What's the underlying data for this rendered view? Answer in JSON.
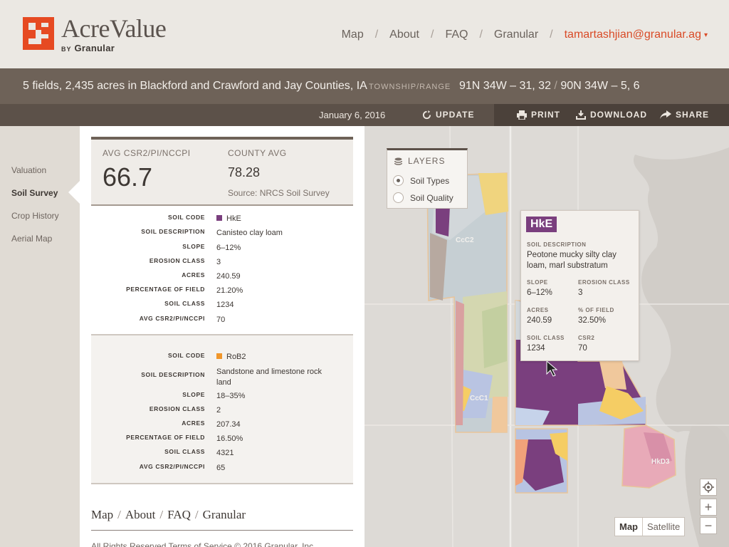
{
  "brand": {
    "name": "AcreValue",
    "by": "BY",
    "company": "Granular",
    "red": "#e64a22"
  },
  "topnav": {
    "items": [
      "Map",
      "About",
      "FAQ",
      "Granular"
    ],
    "user": "tamartashjian@granular.ag"
  },
  "summary": {
    "text": "5 fields, 2,435 acres in Blackford and Crawford and Jay Counties, IA",
    "township_label": "TOWNSHIP/RANGE",
    "township_a": "91N 34W – 31, 32",
    "township_sep": "/",
    "township_b": "90N 34W – 5, 6"
  },
  "actions": {
    "date": "January 6, 2016",
    "update": "UPDATE",
    "print": "PRINT",
    "download": "DOWNLOAD",
    "share": "SHARE"
  },
  "sidebar": {
    "items": [
      "Valuation",
      "Soil Survey",
      "Crop History",
      "Aerial Map"
    ],
    "active": "Soil Survey"
  },
  "averages": {
    "avg_label": "AVG CSR2/PI/NCCPI",
    "avg_value": "66.7",
    "county_label": "COUNTY AVG",
    "county_value": "78.28",
    "source": "Source: NRCS Soil Survey"
  },
  "soil_labels": {
    "code": "Soil code",
    "description": "Soil description",
    "slope": "Slope",
    "erosion": "Erosion class",
    "acres": "Acres",
    "percent": "Percentage of field",
    "class": "Soil class",
    "avg": "Avg CSR2/PI/NCCPI"
  },
  "soils": [
    {
      "code": "HkE",
      "color": "#7a3f7e",
      "description": "Canisteo clay loam",
      "slope": "6–12%",
      "erosion": "3",
      "acres": "240.59",
      "percent": "21.20%",
      "class": "1234",
      "avg": "70"
    },
    {
      "code": "RoB2",
      "color": "#f0962a",
      "description": "Sandstone and limestone rock land",
      "slope": "18–35%",
      "erosion": "2",
      "acres": "207.34",
      "percent": "16.50%",
      "class": "4321",
      "avg": "65"
    }
  ],
  "footer": {
    "links": [
      "Map",
      "About",
      "FAQ",
      "Granular"
    ],
    "copyright": "All Rights Reserved    Terms of Service    © 2016 Granular, Inc."
  },
  "layers": {
    "title": "LAYERS",
    "options": [
      "Soil Types",
      "Soil Quality"
    ],
    "selected": "Soil Types"
  },
  "popup": {
    "code": "HkE",
    "desc_label": "SOIL DESCRIPTION",
    "description": "Peotone mucky silty clay loam, marl substratum",
    "slope_label": "SLOPE",
    "slope": "6–12%",
    "erosion_label": "EROSION CLASS",
    "erosion": "3",
    "acres_label": "ACRES",
    "acres": "240.59",
    "percent_label": "% OF FIELD",
    "percent": "32.50%",
    "class_label": "SOIL CLASS",
    "class": "1234",
    "csr2_label": "CSR2",
    "csr2": "70"
  },
  "map_labels": [
    "CcC2",
    "CcC1",
    "HkD3"
  ],
  "maptype": {
    "map": "Map",
    "satellite": "Satellite"
  },
  "zoom": {
    "in": "+",
    "out": "−"
  }
}
